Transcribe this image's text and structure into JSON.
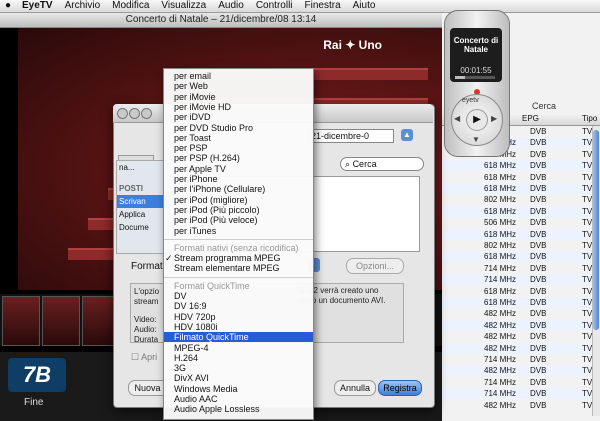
{
  "menubar": {
    "app": "EyeTV",
    "items": [
      "Archivio",
      "Modifica",
      "Visualizza",
      "Audio",
      "Controlli",
      "Finestra",
      "Aiuto"
    ]
  },
  "video": {
    "title": "Concerto di Natale – 21/dicembre/08 13:14",
    "channel_logo": "Rai ✦ Uno",
    "end_label": "Fine"
  },
  "dialog": {
    "filename": "21-dicembre-0",
    "search_placeholder": "Cerca",
    "sidebar_header": "POSTI",
    "sidebar_items": [
      "Scrivan",
      "Applica",
      "Docume"
    ],
    "sidebar_top": "na...",
    "format_label": "Formato",
    "options_button": "Opzioni...",
    "info_lines": [
      "L'opzio",
      "stream",
      "",
      "Video:",
      "Audio:",
      "Durata"
    ],
    "info_right_lines": [
      "G-1/2 verrà creato uno",
      "reato un documento AVI."
    ],
    "info_tail": "ci",
    "open_checkbox": "Apri",
    "new_folder_button": "Nuova c",
    "cancel_button": "Annulla",
    "save_button": "Registra"
  },
  "menu": {
    "items": [
      {
        "label": "per email"
      },
      {
        "label": "per Web"
      },
      {
        "label": "per iMovie"
      },
      {
        "label": "per iMovie HD"
      },
      {
        "label": "per iDVD"
      },
      {
        "label": "per DVD Studio Pro"
      },
      {
        "label": "per Toast"
      },
      {
        "label": "per PSP"
      },
      {
        "label": "per PSP (H.264)"
      },
      {
        "label": "per Apple TV"
      },
      {
        "label": "per iPhone"
      },
      {
        "label": "per l'iPhone (Cellulare)"
      },
      {
        "label": "per iPod (migliore)"
      },
      {
        "label": "per iPod (Più piccolo)"
      },
      {
        "label": "per iPod (Più veloce)"
      },
      {
        "label": "per iTunes"
      },
      {
        "label": "Formati nativi (senza ricodifica)",
        "header": true,
        "sep_before": true
      },
      {
        "label": "Stream programma MPEG",
        "checked": true
      },
      {
        "label": "Stream elementare MPEG"
      },
      {
        "label": "Formati QuickTime",
        "header": true,
        "sep_before": true
      },
      {
        "label": "DV"
      },
      {
        "label": "DV 16:9"
      },
      {
        "label": "HDV 720p"
      },
      {
        "label": "HDV 1080i"
      },
      {
        "label": "Filmato QuickTime",
        "selected": true
      },
      {
        "label": "MPEG-4"
      },
      {
        "label": "H.264"
      },
      {
        "label": "3G"
      },
      {
        "label": "DivX AVI"
      },
      {
        "label": "Windows Media"
      },
      {
        "label": "Audio AAC"
      },
      {
        "label": "Audio Apple Lossless"
      }
    ]
  },
  "remote": {
    "title_line1": "Concerto di",
    "title_line2": "Natale",
    "time": "00:01:55",
    "brand": "eyetv",
    "progress": 0.25
  },
  "program_list": {
    "search_label": "Cerca",
    "columns": [
      "EPG",
      "Tipo"
    ],
    "rows": [
      {
        "freq": "",
        "epg": "DVB",
        "type": "TV"
      },
      {
        "freq": "618 MHz",
        "epg": "DVB",
        "type": "TV"
      },
      {
        "freq": "618 MHz",
        "epg": "DVB",
        "type": "TV"
      },
      {
        "freq": "618 MHz",
        "epg": "DVB",
        "type": "TV"
      },
      {
        "freq": "618 MHz",
        "epg": "DVB",
        "type": "TV"
      },
      {
        "freq": "618 MHz",
        "epg": "DVB",
        "type": "TV"
      },
      {
        "freq": "802 MHz",
        "epg": "DVB",
        "type": "TV"
      },
      {
        "freq": "618 MHz",
        "epg": "DVB",
        "type": "TV"
      },
      {
        "freq": "506 MHz",
        "epg": "DVB",
        "type": "TV"
      },
      {
        "freq": "618 MHz",
        "epg": "DVB",
        "type": "TV"
      },
      {
        "freq": "802 MHz",
        "epg": "DVB",
        "type": "TV"
      },
      {
        "freq": "618 MHz",
        "epg": "DVB",
        "type": "TV"
      },
      {
        "freq": "714 MHz",
        "epg": "DVB",
        "type": "TV"
      },
      {
        "freq": "714 MHz",
        "epg": "DVB",
        "type": "TV"
      },
      {
        "freq": "618 MHz",
        "epg": "DVB",
        "type": "TV"
      },
      {
        "freq": "618 MHz",
        "epg": "DVB",
        "type": "TV"
      },
      {
        "freq": "482 MHz",
        "epg": "DVB",
        "type": "TV"
      },
      {
        "freq": "482 MHz",
        "epg": "DVB",
        "type": "TV"
      },
      {
        "freq": "482 MHz",
        "epg": "DVB",
        "type": "TV"
      },
      {
        "freq": "482 MHz",
        "epg": "DVB",
        "type": "TV"
      },
      {
        "freq": "714 MHz",
        "epg": "DVB",
        "type": "TV"
      },
      {
        "freq": "482 MHz",
        "epg": "DVB",
        "type": "TV"
      },
      {
        "freq": "714 MHz",
        "epg": "DVB",
        "type": "TV"
      },
      {
        "freq": "714 MHz",
        "epg": "DVB",
        "type": "TV"
      },
      {
        "freq": "482 MHz",
        "epg": "DVB",
        "type": "TV"
      }
    ]
  }
}
